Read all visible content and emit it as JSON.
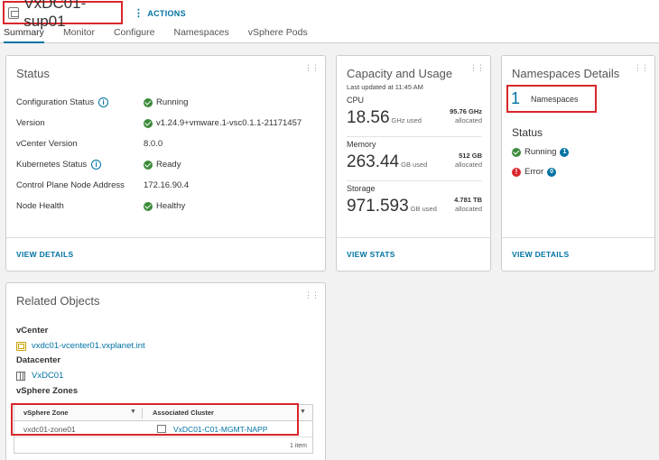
{
  "header": {
    "title": "VxDC01-sup01",
    "actions_label": "ACTIONS",
    "tabs": [
      {
        "label": "Summary",
        "active": true
      },
      {
        "label": "Monitor"
      },
      {
        "label": "Configure"
      },
      {
        "label": "Namespaces"
      },
      {
        "label": "vSphere Pods"
      }
    ]
  },
  "status_card": {
    "title": "Status",
    "rows": [
      {
        "label": "Configuration Status",
        "value": "Running"
      },
      {
        "label": "Version",
        "value": "v1.24.9+vmware.1-vsc0.1.1-21171457"
      },
      {
        "label": "vCenter Version",
        "value": "8.0.0"
      },
      {
        "label": "Kubernetes Status",
        "value": "Ready"
      },
      {
        "label": "Control Plane Node Address",
        "value": "172.16.90.4"
      },
      {
        "label": "Node Health",
        "value": "Healthy"
      }
    ],
    "footer_link": "VIEW DETAILS"
  },
  "capacity_card": {
    "title": "Capacity and Usage",
    "subtitle": "Last updated at 11:45 AM",
    "cpu": {
      "label": "CPU",
      "used": "18.56",
      "unit": "GHz used",
      "allocated": "95.76 GHz",
      "allocated_label": "allocated"
    },
    "memory": {
      "label": "Memory",
      "used": "263.44",
      "unit": "GB used",
      "allocated": "512 GB",
      "allocated_label": "allocated"
    },
    "storage": {
      "label": "Storage",
      "used": "971.593",
      "unit": "GB used",
      "allocated": "4.781 TB",
      "allocated_label": "allocated"
    },
    "footer_link": "VIEW STATS"
  },
  "namespaces_card": {
    "title": "Namespaces Details",
    "count": "1",
    "count_label": "Namespaces",
    "status_title": "Status",
    "running_label": "Running",
    "running_count": "1",
    "error_label": "Error",
    "error_count": "0",
    "footer_link": "VIEW DETAILS"
  },
  "related_card": {
    "title": "Related Objects",
    "vcenter_title": "vCenter",
    "vcenter_link": "vxdc01-vcenter01.vxplanet.int",
    "datacenter_title": "Datacenter",
    "datacenter_link": "VxDC01",
    "zones_title": "vSphere Zones",
    "grid": {
      "col_zone": "vSphere Zone",
      "col_cluster": "Associated Cluster",
      "rows": [
        {
          "zone": "vxdc01-zone01",
          "cluster": "VxDC01-C01-MGMT-NAPP"
        }
      ],
      "footer": "1 item"
    }
  },
  "colors": {
    "accent": "#0072a3",
    "success": "#3c8b3c",
    "error": "#d9262b",
    "highlight": "#d9262b"
  }
}
